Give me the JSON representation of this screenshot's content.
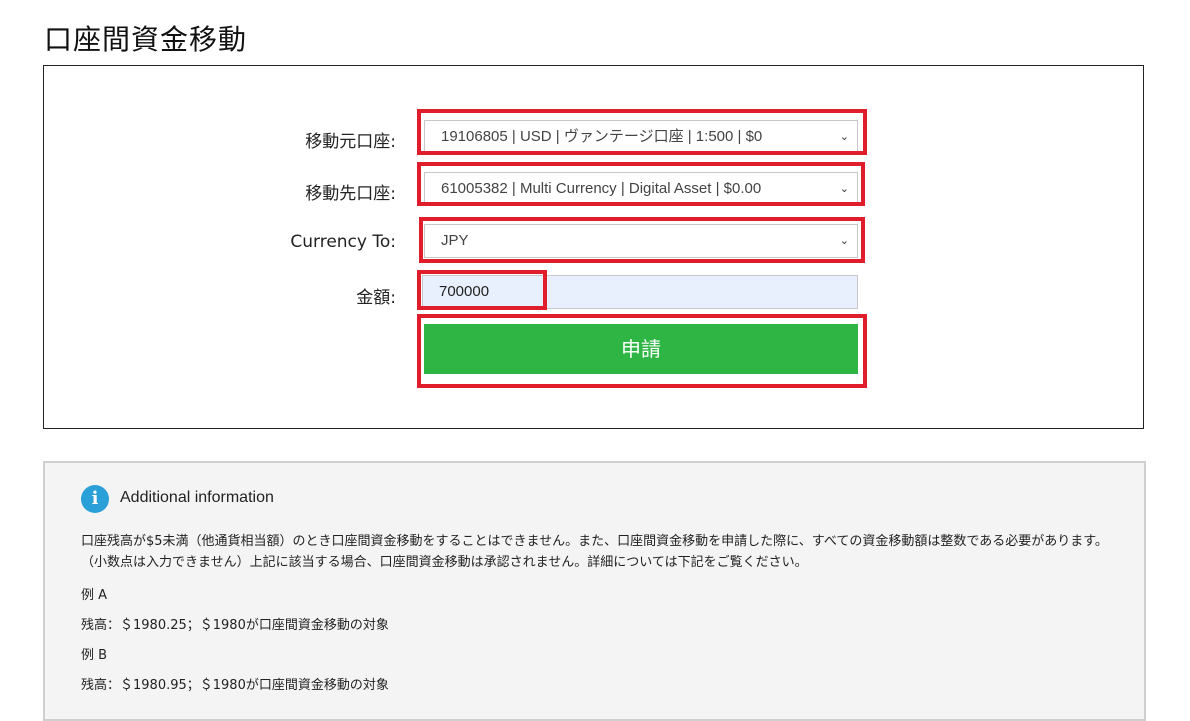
{
  "page": {
    "title": "口座間資金移動"
  },
  "form": {
    "from_account": {
      "label": "移動元口座:",
      "value": "19106805 | USD | ヴァンテージ口座 | 1:500 | $0"
    },
    "to_account": {
      "label": "移動先口座:",
      "value": "61005382 | Multi Currency | Digital Asset | $0.00"
    },
    "currency_to": {
      "label": "Currency To:",
      "value": "JPY"
    },
    "amount": {
      "label": "金額:",
      "value": "700000"
    },
    "submit_label": "申請"
  },
  "info": {
    "icon": "info-icon",
    "title": "Additional information",
    "paragraph": "口座残高が$5未満（他通貨相当額）のとき口座間資金移動をすることはできません。また、口座間資金移動を申請した際に、すべての資金移動額は整数である必要があります。（小数点は入力できません）上記に該当する場合、口座間資金移動は承認されません。詳細については下記をご覧ください。",
    "example_a_label": "例 A",
    "example_a_text": "残高：＄1980.25；＄1980が口座間資金移動の対象",
    "example_b_label": "例 B",
    "example_b_text": "残高：＄1980.95；＄1980が口座間資金移動の対象"
  },
  "colors": {
    "highlight": "#e01e2b",
    "submit": "#2fb543",
    "info_icon": "#2a9fd8",
    "amount_bg": "#e8f0fe"
  }
}
